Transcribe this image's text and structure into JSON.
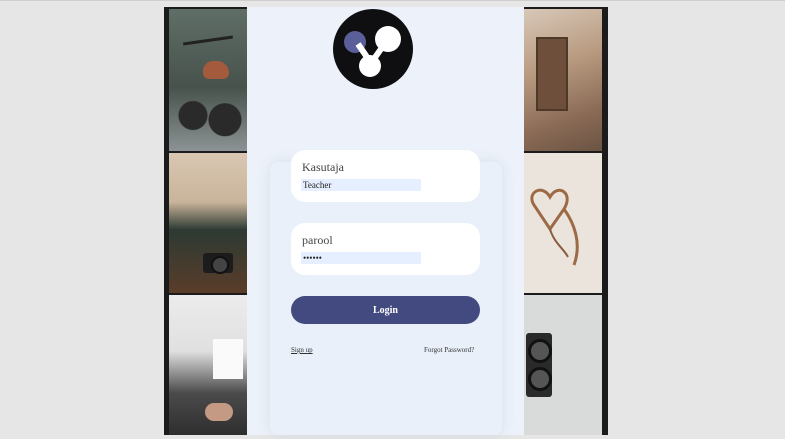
{
  "colors": {
    "accent": "#434a7f",
    "panel": "#edf2fa",
    "input_fill": "#e6efff",
    "frame": "#1b1b1b"
  },
  "logo": {
    "icon": "molecule-logo-icon"
  },
  "username": {
    "label": "Kasutaja",
    "value": "Teacher"
  },
  "password": {
    "label": "parool",
    "value": "••••••"
  },
  "login": {
    "label": "Login"
  },
  "links": {
    "signup": "Sign up",
    "forgot": "Forgot Password?"
  },
  "photos": [
    "motorcycle-photo",
    "camera-on-table-photo",
    "typewriter-photo",
    "old-wall-door-photo",
    "heart-strap-photo",
    "vintage-camera-photo"
  ]
}
